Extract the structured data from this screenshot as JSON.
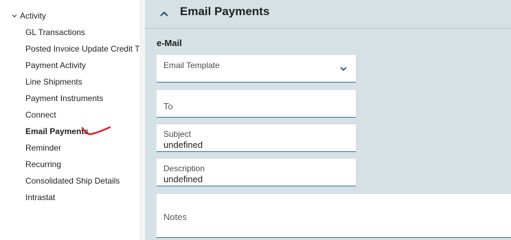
{
  "sidebar": {
    "parent_label": "Activity",
    "items": [
      {
        "label": "GL Transactions"
      },
      {
        "label": "Posted Invoice Update Credit Tr"
      },
      {
        "label": "Payment Activity"
      },
      {
        "label": "Line Shipments"
      },
      {
        "label": "Payment Instruments"
      },
      {
        "label": "Connect"
      },
      {
        "label": "Email Payments",
        "active": true
      },
      {
        "label": "Reminder"
      },
      {
        "label": "Recurring"
      },
      {
        "label": "Consolidated Ship Details"
      },
      {
        "label": "Intrastat"
      }
    ]
  },
  "main": {
    "section_title": "Email Payments",
    "group_label": "e-Mail",
    "email_template": {
      "label": "Email Template",
      "value": ""
    },
    "to": {
      "placeholder": "To"
    },
    "subject": {
      "label": "Subject",
      "value": "undefined"
    },
    "description": {
      "label": "Description",
      "value": "undefined"
    },
    "notes": {
      "placeholder": "Notes"
    }
  },
  "colors": {
    "panel_bg": "#d6e1e6",
    "field_underline": "#2a6f8f",
    "annotation": "#e0202a"
  },
  "icons": [
    "chevron-down-icon",
    "chevron-up-icon",
    "dropdown-chevron-icon"
  ]
}
